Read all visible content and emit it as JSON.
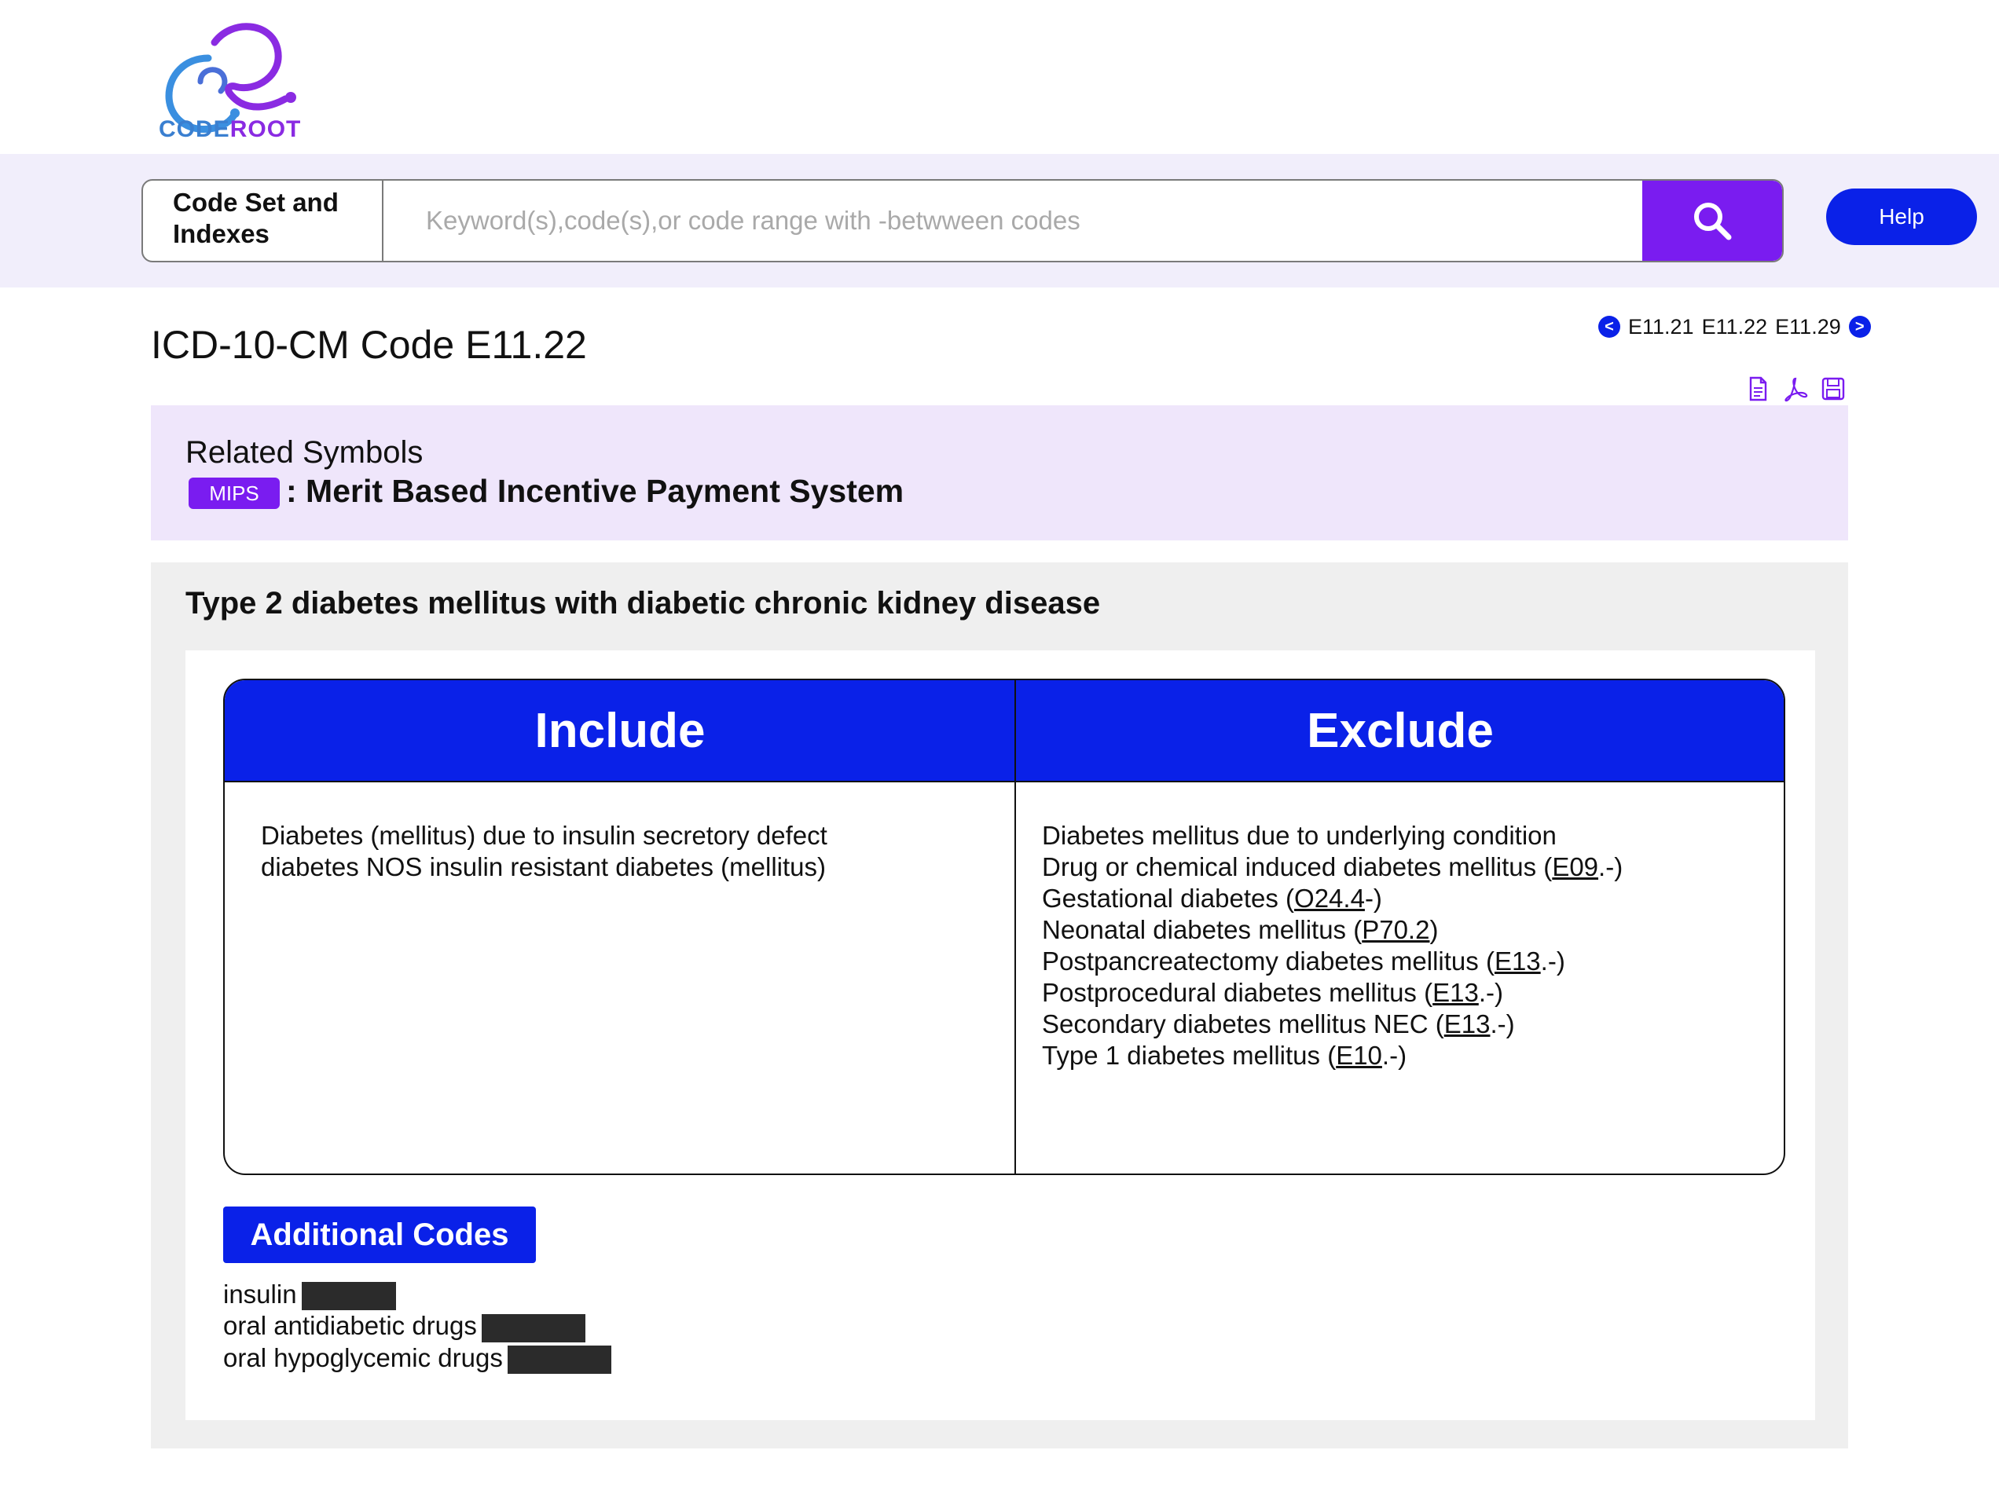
{
  "brand": {
    "name_part1": "CODE",
    "name_part2": "ROOT",
    "colors": {
      "blue": "#3a7fd0",
      "purple": "#8a2be2"
    }
  },
  "search": {
    "codeset_label": "Code Set and Indexes",
    "placeholder": "Keyword(s),code(s),or code range with -betwween codes",
    "value": "",
    "button_icon": "search-icon"
  },
  "help_label": "Help",
  "page_title": "ICD-10-CM Code E11.22",
  "code_nav": {
    "prev_icon": "chevron-left-icon",
    "codes": [
      "E11.21",
      "E11.22",
      "E11.29"
    ],
    "next_icon": "chevron-right-icon"
  },
  "export_icons": [
    "document-icon",
    "pdf-icon",
    "save-icon"
  ],
  "related_symbols": {
    "title": "Related Symbols",
    "badge": "MIPS",
    "description": ": Merit Based Incentive Payment System"
  },
  "description": "Type 2 diabetes mellitus with diabetic chronic kidney disease",
  "include_exclude": {
    "include_header": "Include",
    "exclude_header": "Exclude",
    "include_lines": [
      "Diabetes (mellitus) due to insulin secretory defect",
      "diabetes NOS insulin resistant diabetes (mellitus)"
    ],
    "exclude_items": [
      {
        "text": "Diabetes mellitus due to underlying condition",
        "code": "",
        "suffix": ""
      },
      {
        "text": "Drug or chemical induced diabetes mellitus (",
        "code": "E09",
        "suffix": ".-)"
      },
      {
        "text": "Gestational diabetes (",
        "code": "O24.4",
        "suffix": "-)"
      },
      {
        "text": "Neonatal diabetes mellitus (",
        "code": "P70.2",
        "suffix": ")"
      },
      {
        "text": "Postpancreatectomy diabetes mellitus (",
        "code": "E13",
        "suffix": ".-)"
      },
      {
        "text": "Postprocedural diabetes mellitus (",
        "code": "E13",
        "suffix": ".-)"
      },
      {
        "text": "Secondary diabetes mellitus NEC (",
        "code": "E13",
        "suffix": ".-)"
      },
      {
        "text": "Type 1 diabetes mellitus (",
        "code": "E10",
        "suffix": ".-)"
      }
    ]
  },
  "additional_codes": {
    "label": "Additional Codes",
    "items": [
      "insulin",
      "oral antidiabetic drugs",
      "oral hypoglycemic drugs"
    ]
  },
  "colors": {
    "primary_blue": "#0a21e8",
    "accent_purple": "#7a1cf0",
    "band": "#f1eefb",
    "related_bg": "#efe6fb",
    "panel_bg": "#efefef"
  }
}
